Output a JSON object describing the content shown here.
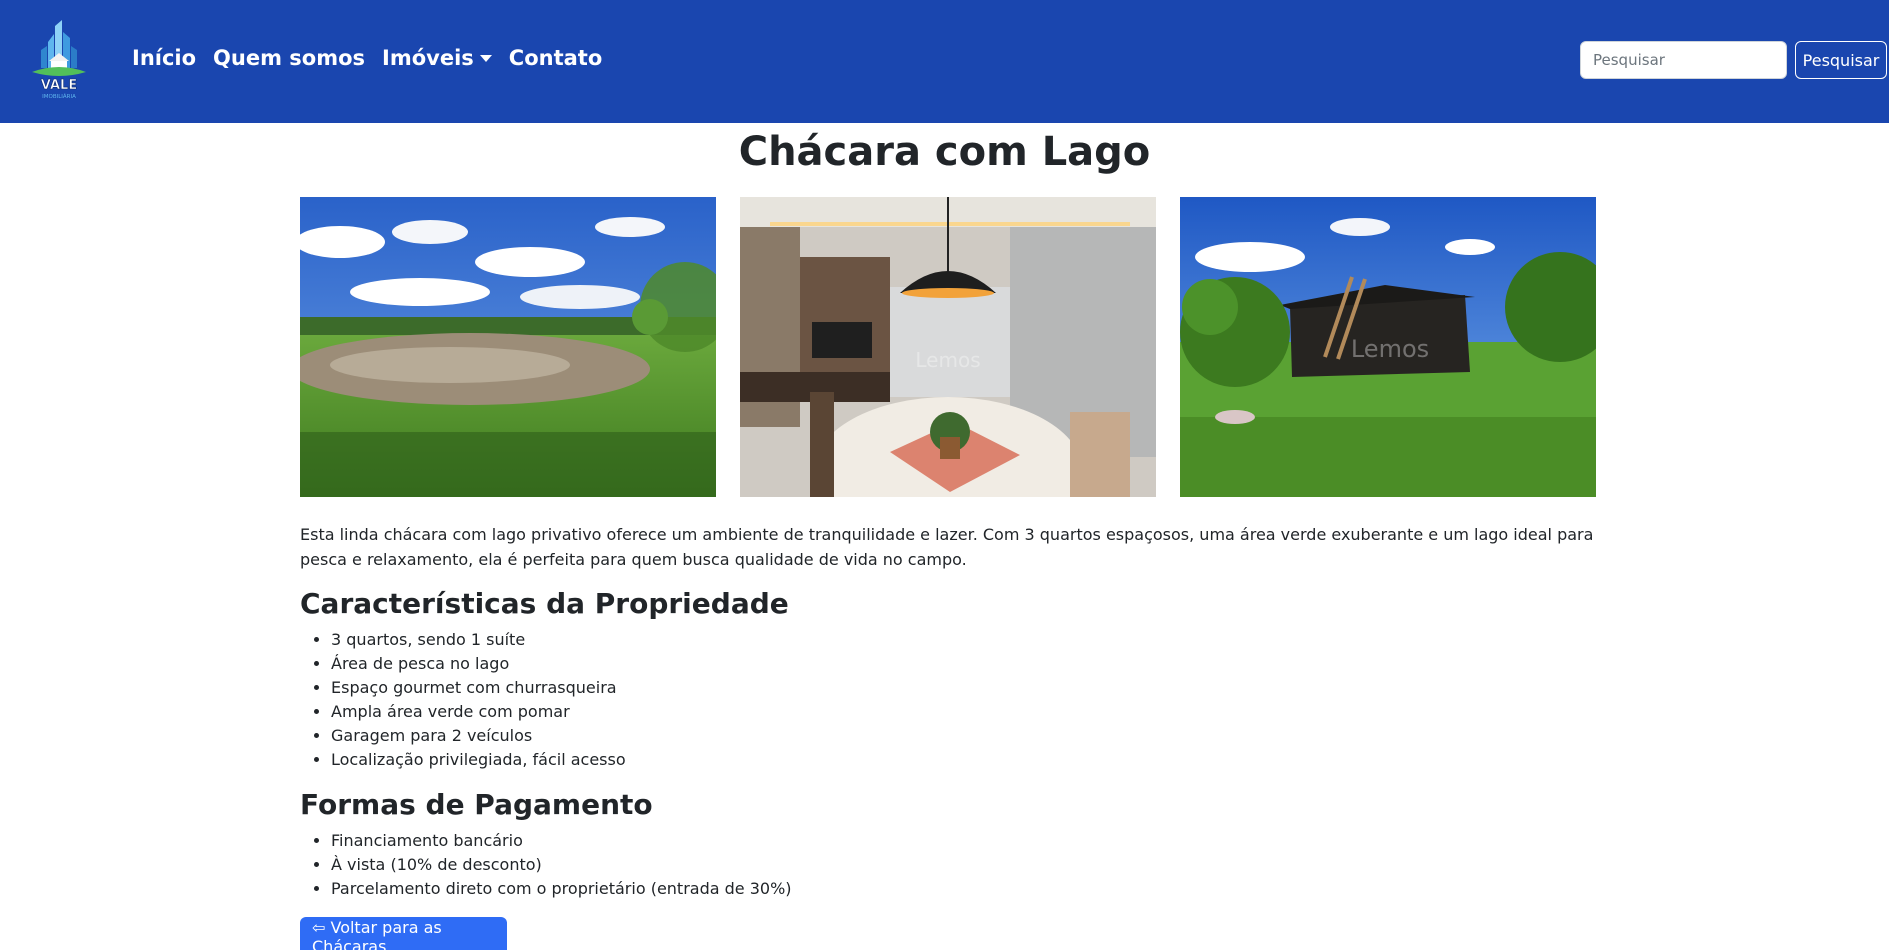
{
  "navbar": {
    "brand": {
      "name": "VALE",
      "tagline": "IMOBILIÁRIA"
    },
    "links": [
      {
        "label": "Início"
      },
      {
        "label": "Quem somos"
      },
      {
        "label": "Imóveis",
        "dropdown": true
      },
      {
        "label": "Contato"
      }
    ],
    "search": {
      "placeholder": "Pesquisar",
      "button_label": "Pesquisar"
    },
    "colors": {
      "navbar_bg": "#1a46af",
      "text": "#ffffff"
    }
  },
  "page": {
    "title": "Chácara com Lago",
    "photos": [
      {
        "subject": "lake-with-green-field-photo"
      },
      {
        "subject": "dining-room-interior-photo",
        "watermark": "Lemos"
      },
      {
        "subject": "dark-wooden-cabin-in-garden-photo",
        "watermark": "Lemos"
      }
    ],
    "description": "Esta linda chácara com lago privativo oferece um ambiente de tranquilidade e lazer. Com 3 quartos espaçosos, uma área verde exuberante e um lago ideal para pesca e relaxamento, ela é perfeita para quem busca qualidade de vida no campo.",
    "features": {
      "title": "Características da Propriedade",
      "items": [
        "3 quartos, sendo 1 suíte",
        "Área de pesca no lago",
        "Espaço gourmet com churrasqueira",
        "Ampla área verde com pomar",
        "Garagem para 2 veículos",
        "Localização privilegiada, fácil acesso"
      ]
    },
    "payment": {
      "title": "Formas de Pagamento",
      "items": [
        "Financiamento bancário",
        "À vista (10% de desconto)",
        "Parcelamento direto com o proprietário (entrada de 30%)"
      ]
    },
    "back_button": {
      "label": "⇦ Voltar para as Chácaras",
      "color": "#2f6cf5"
    }
  }
}
